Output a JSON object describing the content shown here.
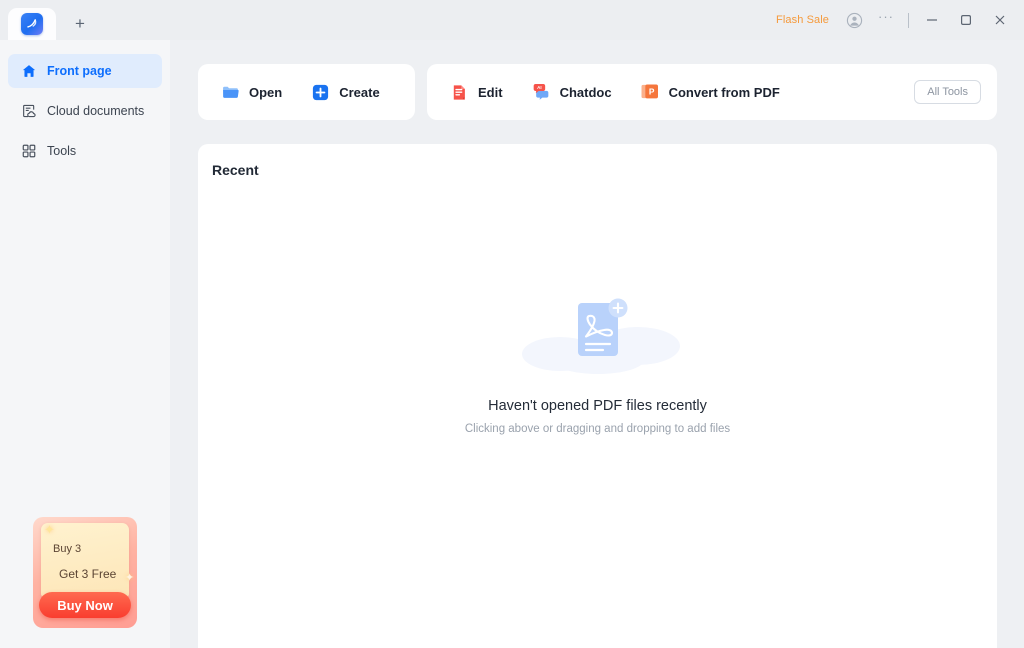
{
  "titlebar": {
    "app_icon_name": "app-logo-icon",
    "new_tab_label": "+",
    "flash_sale_label": "Flash Sale",
    "more_label": "···",
    "minimize_label": "─",
    "maximize_label": "□",
    "close_label": "✕",
    "accent_orange": "#f59a3c"
  },
  "sidebar": {
    "items": [
      {
        "label": "Front page",
        "icon": "home-icon",
        "active": true
      },
      {
        "label": "Cloud documents",
        "icon": "cloud-document-icon",
        "active": false
      },
      {
        "label": "Tools",
        "icon": "grid-tools-icon",
        "active": false
      }
    ],
    "active_color": "#0d6efd",
    "active_bg": "#e0ecfd"
  },
  "promo": {
    "line1": "Buy 3",
    "line2": "Get 3 Free",
    "button_label": "Buy Now",
    "button_color": "#f93d2f"
  },
  "toolbar": {
    "group_one": [
      {
        "label": "Open",
        "icon": "folder-icon",
        "color": "#3b89f5"
      },
      {
        "label": "Create",
        "icon": "plus-square-icon",
        "color": "#1a73f0"
      }
    ],
    "group_two": [
      {
        "label": "Edit",
        "icon": "edit-document-icon",
        "color": "#f6534a"
      },
      {
        "label": "Chatdoc",
        "icon": "ai-chat-bubble-icon",
        "color": "#f6534a"
      },
      {
        "label": "Convert from PDF",
        "icon": "convert-powerpoint-icon",
        "color": "#f5763c"
      }
    ],
    "all_tools_label": "All Tools"
  },
  "main": {
    "recent_title": "Recent",
    "empty_state": {
      "icon": "pdf-add-file-icon",
      "title": "Haven't opened PDF files recently",
      "subtitle": "Clicking above or dragging and dropping to add files"
    }
  }
}
